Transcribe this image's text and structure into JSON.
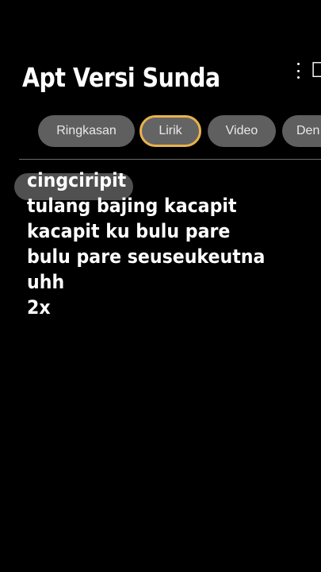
{
  "header": {
    "title": "Apt Versi Sunda",
    "edge_glyph": "☐"
  },
  "tabs": [
    {
      "label": "Ringkasan",
      "selected": false
    },
    {
      "label": "Lirik",
      "selected": true
    },
    {
      "label": "Video",
      "selected": false
    },
    {
      "label": "Den",
      "selected": false
    }
  ],
  "lyrics": {
    "lines": [
      "cingciripit",
      "tulang bajing kacapit",
      "kacapit ku bulu pare",
      "bulu pare seuseukeutna",
      "uhh",
      "2x"
    ],
    "active_line_index": 0
  },
  "colors": {
    "background": "#000000",
    "tab_background": "#5f5f5f",
    "tab_selected_border": "#e9b24a",
    "text": "#ffffff"
  }
}
